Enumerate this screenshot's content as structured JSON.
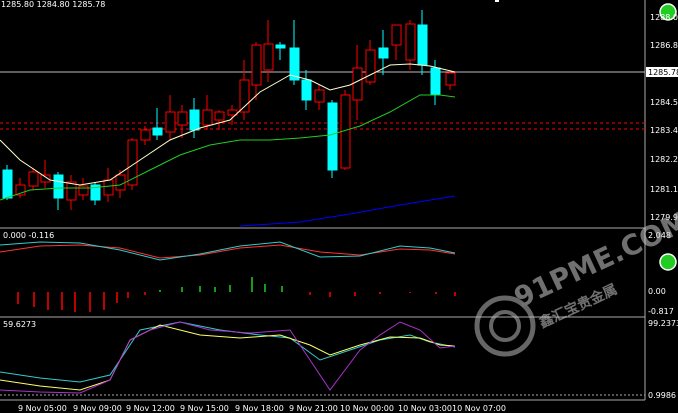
{
  "header": {
    "ohlc_text": "1285.80 1284.80 1285.78"
  },
  "price_axis": {
    "ticks": [
      "1288.00",
      "1286.85",
      "1285.78",
      "1284.55",
      "1283.40",
      "1282.25",
      "1281.10",
      "1279.95"
    ],
    "current": "1285.78"
  },
  "macd": {
    "label": "0.000 -0.116",
    "ticks": [
      "2.048",
      "0.00",
      "-0.817"
    ]
  },
  "stoch": {
    "label": "59.6273",
    "ticks": [
      "99.2373",
      "0.9986"
    ]
  },
  "time_axis": [
    "9 Nov 05:00",
    "9 Nov 09:00",
    "9 Nov 12:00",
    "9 Nov 15:00",
    "9 Nov 18:00",
    "9 Nov 21:00",
    "10 Nov 00:00",
    "10 Nov 03:00",
    "10 Nov 07:00"
  ],
  "watermark": {
    "text_en": "91PME.COM",
    "text_cn": "鑫汇宝贵金属"
  },
  "colors": {
    "bull": "#ff0000",
    "bear": "#00ffff",
    "bear_fill": "#00ffff",
    "ma_fast": "#ffffcc",
    "ma_mid": "#22cc22",
    "ma_slow": "#0000ff",
    "grid": "#ffffff"
  }
}
